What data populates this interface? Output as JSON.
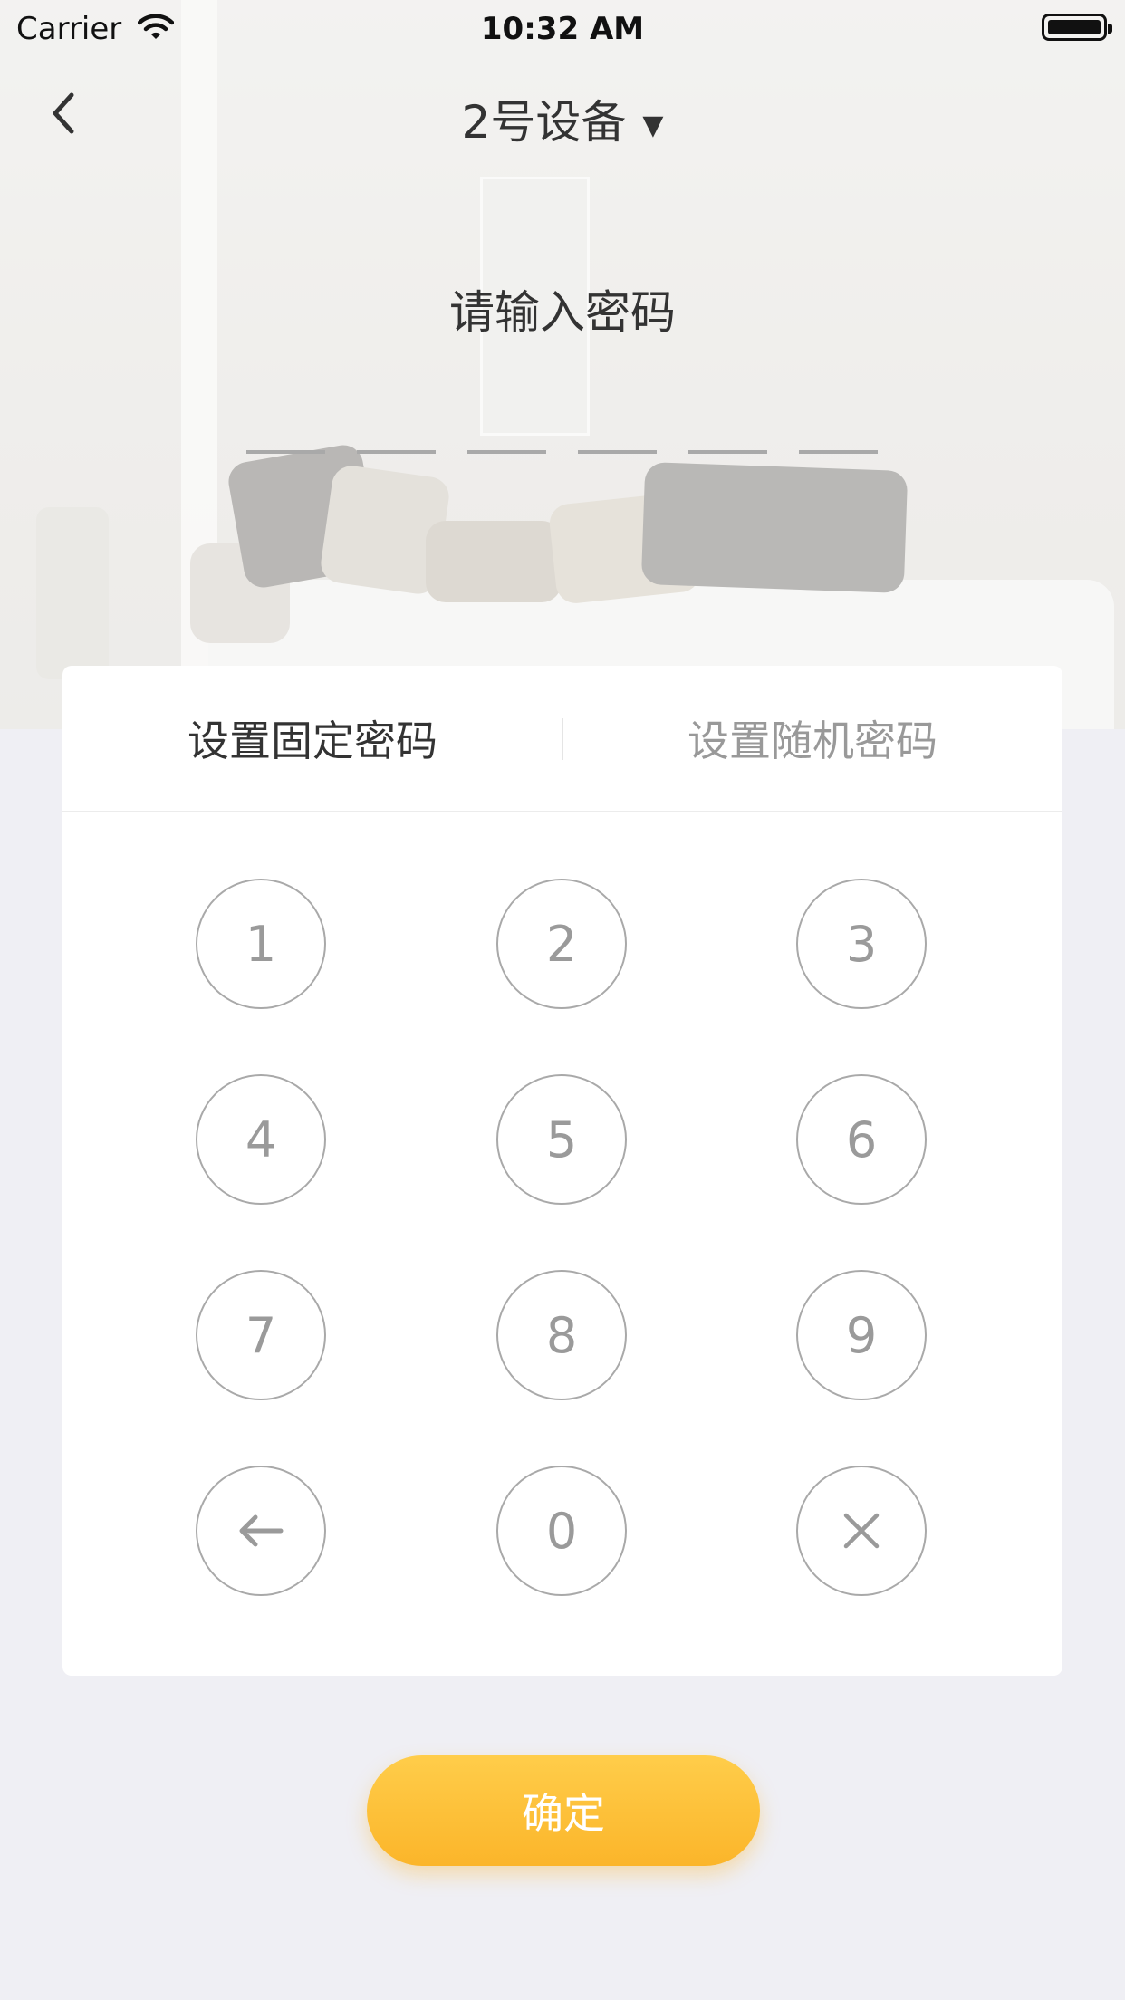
{
  "status_bar": {
    "carrier": "Carrier",
    "time": "10:32 AM"
  },
  "nav": {
    "title": "2号设备",
    "caret": "▼"
  },
  "prompt": "请输入密码",
  "pin_length": 6,
  "tabs": [
    {
      "label": "设置固定密码",
      "active": true
    },
    {
      "label": "设置随机密码",
      "active": false
    }
  ],
  "keypad": {
    "digits": [
      "1",
      "2",
      "3",
      "4",
      "5",
      "6",
      "7",
      "8",
      "9",
      "0"
    ]
  },
  "confirm_label": "确定",
  "colors": {
    "accent": "#fbb52a",
    "key_border": "#a9a9a9",
    "background": "#efeff4"
  }
}
